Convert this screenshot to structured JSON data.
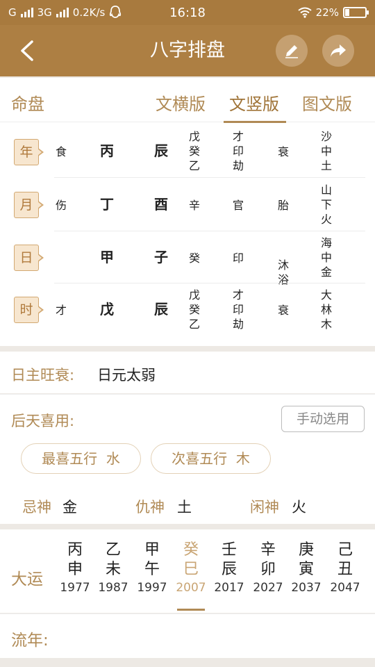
{
  "status": {
    "carrier": "G",
    "network": "3G",
    "speed": "0.2K/s",
    "time": "16:18",
    "battery": "22%",
    "battery_level": 0.22
  },
  "nav": {
    "title": "八字排盘"
  },
  "tabs": {
    "section_label": "命盘",
    "items": [
      "文横版",
      "文竖版",
      "图文版"
    ],
    "active_index": 1
  },
  "pillars": [
    {
      "label": "年",
      "shishen": "食",
      "gan": "丙",
      "zhi": "辰",
      "canggan": [
        "戊",
        "癸",
        "乙"
      ],
      "fushen": [
        "才",
        "印",
        "劫"
      ],
      "changsheng": "衰",
      "nayin": [
        "沙",
        "中",
        "土"
      ]
    },
    {
      "label": "月",
      "shishen": "伤",
      "gan": "丁",
      "zhi": "酉",
      "canggan": [
        "辛"
      ],
      "fushen": [
        "官"
      ],
      "changsheng": "胎",
      "nayin": [
        "山",
        "下",
        "火"
      ]
    },
    {
      "label": "日",
      "shishen": "",
      "gan": "甲",
      "zhi": "子",
      "canggan": [
        "癸"
      ],
      "fushen": [
        "印"
      ],
      "changsheng": "沐浴",
      "nayin": [
        "海",
        "中",
        "金"
      ]
    },
    {
      "label": "时",
      "shishen": "才",
      "gan": "戊",
      "zhi": "辰",
      "canggan": [
        "戊",
        "癸",
        "乙"
      ],
      "fushen": [
        "才",
        "印",
        "劫"
      ],
      "changsheng": "衰",
      "nayin": [
        "大",
        "林",
        "木"
      ]
    }
  ],
  "wangshuai": {
    "label": "日主旺衰:",
    "value": "日元太弱"
  },
  "xiyong": {
    "label": "后天喜用:",
    "manual_button": "手动选用",
    "zuixi_label": "最喜五行",
    "zuixi_value": "水",
    "cixi_label": "次喜五行",
    "cixi_value": "木"
  },
  "shens": [
    {
      "label": "忌神",
      "value": "金"
    },
    {
      "label": "仇神",
      "value": "土"
    },
    {
      "label": "闲神",
      "value": "火"
    }
  ],
  "dayun": {
    "label": "大运",
    "items": [
      {
        "gan": "丙",
        "zhi": "申",
        "year": "1977"
      },
      {
        "gan": "乙",
        "zhi": "未",
        "year": "1987"
      },
      {
        "gan": "甲",
        "zhi": "午",
        "year": "1997"
      },
      {
        "gan": "癸",
        "zhi": "巳",
        "year": "2007"
      },
      {
        "gan": "壬",
        "zhi": "辰",
        "year": "2017"
      },
      {
        "gan": "辛",
        "zhi": "卯",
        "year": "2027"
      },
      {
        "gan": "庚",
        "zhi": "寅",
        "year": "2037"
      },
      {
        "gan": "己",
        "zhi": "丑",
        "year": "2047"
      }
    ],
    "active_index": 3
  },
  "liunian": {
    "label": "流年:"
  },
  "colors": {
    "brand": "#ad7f43",
    "accent_gold": "#b08a55",
    "active_light": "#c9a574"
  }
}
